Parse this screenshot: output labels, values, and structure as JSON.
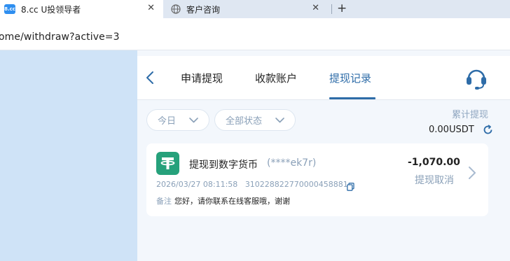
{
  "browser": {
    "tabs": [
      {
        "favicon_text": "8.cc",
        "title": "8.cc U投领导者",
        "close": "✕"
      },
      {
        "title": "客户咨询",
        "close": "✕"
      }
    ],
    "new_tab": "+",
    "url": "ome/withdraw?active=3"
  },
  "header": {
    "back": "〈",
    "tabs": [
      "申请提现",
      "收款账户",
      "提现记录"
    ],
    "active_tab_index": 2,
    "support_icon": "headset-icon"
  },
  "filters": {
    "date_label": "今日",
    "status_label": "全部状态"
  },
  "summary": {
    "cumulative_label": "累计提现",
    "cumulative_value": "0.00USDT",
    "refresh_icon": "refresh-icon"
  },
  "records": [
    {
      "icon": "tether-icon",
      "title": "提现到数字货币",
      "account_mask": "(****ek7r)",
      "amount": "-1,070.00",
      "status": "提现取消",
      "datetime": "2026/03/27 08:11:58",
      "order_id": "310228822770000458881",
      "note_label": "备注",
      "note_text": "您好，请你联系在线客服哦，谢谢"
    }
  ],
  "colors": {
    "accent": "#2e6ca8",
    "tether_green": "#26a17b",
    "muted_text": "#8aa0b8",
    "page_bg": "#cfe3f7"
  }
}
